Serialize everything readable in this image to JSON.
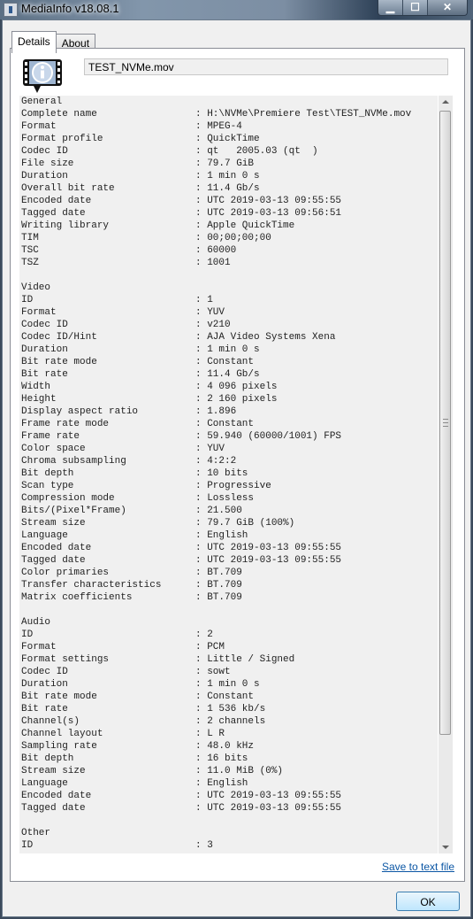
{
  "window": {
    "title": "MediaInfo v18.08.1",
    "buttons": {
      "minimize": "▁",
      "maximize": "☐",
      "close": "✕"
    }
  },
  "tabs": [
    {
      "label": "Details",
      "active": true
    },
    {
      "label": "About",
      "active": false
    }
  ],
  "file_name": "TEST_NVMe.mov",
  "report_lines": [
    {
      "k": "General",
      "v": null
    },
    {
      "k": "Complete name",
      "v": "H:\\NVMe\\Premiere Test\\TEST_NVMe.mov"
    },
    {
      "k": "Format",
      "v": "MPEG-4"
    },
    {
      "k": "Format profile",
      "v": "QuickTime"
    },
    {
      "k": "Codec ID",
      "v": "qt   2005.03 (qt  )"
    },
    {
      "k": "File size",
      "v": "79.7 GiB"
    },
    {
      "k": "Duration",
      "v": "1 min 0 s"
    },
    {
      "k": "Overall bit rate",
      "v": "11.4 Gb/s"
    },
    {
      "k": "Encoded date",
      "v": "UTC 2019-03-13 09:55:55"
    },
    {
      "k": "Tagged date",
      "v": "UTC 2019-03-13 09:56:51"
    },
    {
      "k": "Writing library",
      "v": "Apple QuickTime"
    },
    {
      "k": "TIM",
      "v": "00;00;00;00"
    },
    {
      "k": "TSC",
      "v": "60000"
    },
    {
      "k": "TSZ",
      "v": "1001"
    },
    {
      "k": "",
      "v": null
    },
    {
      "k": "Video",
      "v": null
    },
    {
      "k": "ID",
      "v": "1"
    },
    {
      "k": "Format",
      "v": "YUV"
    },
    {
      "k": "Codec ID",
      "v": "v210"
    },
    {
      "k": "Codec ID/Hint",
      "v": "AJA Video Systems Xena"
    },
    {
      "k": "Duration",
      "v": "1 min 0 s"
    },
    {
      "k": "Bit rate mode",
      "v": "Constant"
    },
    {
      "k": "Bit rate",
      "v": "11.4 Gb/s"
    },
    {
      "k": "Width",
      "v": "4 096 pixels"
    },
    {
      "k": "Height",
      "v": "2 160 pixels"
    },
    {
      "k": "Display aspect ratio",
      "v": "1.896"
    },
    {
      "k": "Frame rate mode",
      "v": "Constant"
    },
    {
      "k": "Frame rate",
      "v": "59.940 (60000/1001) FPS"
    },
    {
      "k": "Color space",
      "v": "YUV"
    },
    {
      "k": "Chroma subsampling",
      "v": "4:2:2"
    },
    {
      "k": "Bit depth",
      "v": "10 bits"
    },
    {
      "k": "Scan type",
      "v": "Progressive"
    },
    {
      "k": "Compression mode",
      "v": "Lossless"
    },
    {
      "k": "Bits/(Pixel*Frame)",
      "v": "21.500"
    },
    {
      "k": "Stream size",
      "v": "79.7 GiB (100%)"
    },
    {
      "k": "Language",
      "v": "English"
    },
    {
      "k": "Encoded date",
      "v": "UTC 2019-03-13 09:55:55"
    },
    {
      "k": "Tagged date",
      "v": "UTC 2019-03-13 09:55:55"
    },
    {
      "k": "Color primaries",
      "v": "BT.709"
    },
    {
      "k": "Transfer characteristics",
      "v": "BT.709"
    },
    {
      "k": "Matrix coefficients",
      "v": "BT.709"
    },
    {
      "k": "",
      "v": null
    },
    {
      "k": "Audio",
      "v": null
    },
    {
      "k": "ID",
      "v": "2"
    },
    {
      "k": "Format",
      "v": "PCM"
    },
    {
      "k": "Format settings",
      "v": "Little / Signed"
    },
    {
      "k": "Codec ID",
      "v": "sowt"
    },
    {
      "k": "Duration",
      "v": "1 min 0 s"
    },
    {
      "k": "Bit rate mode",
      "v": "Constant"
    },
    {
      "k": "Bit rate",
      "v": "1 536 kb/s"
    },
    {
      "k": "Channel(s)",
      "v": "2 channels"
    },
    {
      "k": "Channel layout",
      "v": "L R"
    },
    {
      "k": "Sampling rate",
      "v": "48.0 kHz"
    },
    {
      "k": "Bit depth",
      "v": "16 bits"
    },
    {
      "k": "Stream size",
      "v": "11.0 MiB (0%)"
    },
    {
      "k": "Language",
      "v": "English"
    },
    {
      "k": "Encoded date",
      "v": "UTC 2019-03-13 09:55:55"
    },
    {
      "k": "Tagged date",
      "v": "UTC 2019-03-13 09:55:55"
    },
    {
      "k": "",
      "v": null
    },
    {
      "k": "Other",
      "v": null
    },
    {
      "k": "ID",
      "v": "3"
    }
  ],
  "separator": ": ",
  "save_link": "Save to text file",
  "ok_button": "OK",
  "colors": {
    "link": "#0b56a4",
    "ok_border": "#3c7fb1"
  }
}
